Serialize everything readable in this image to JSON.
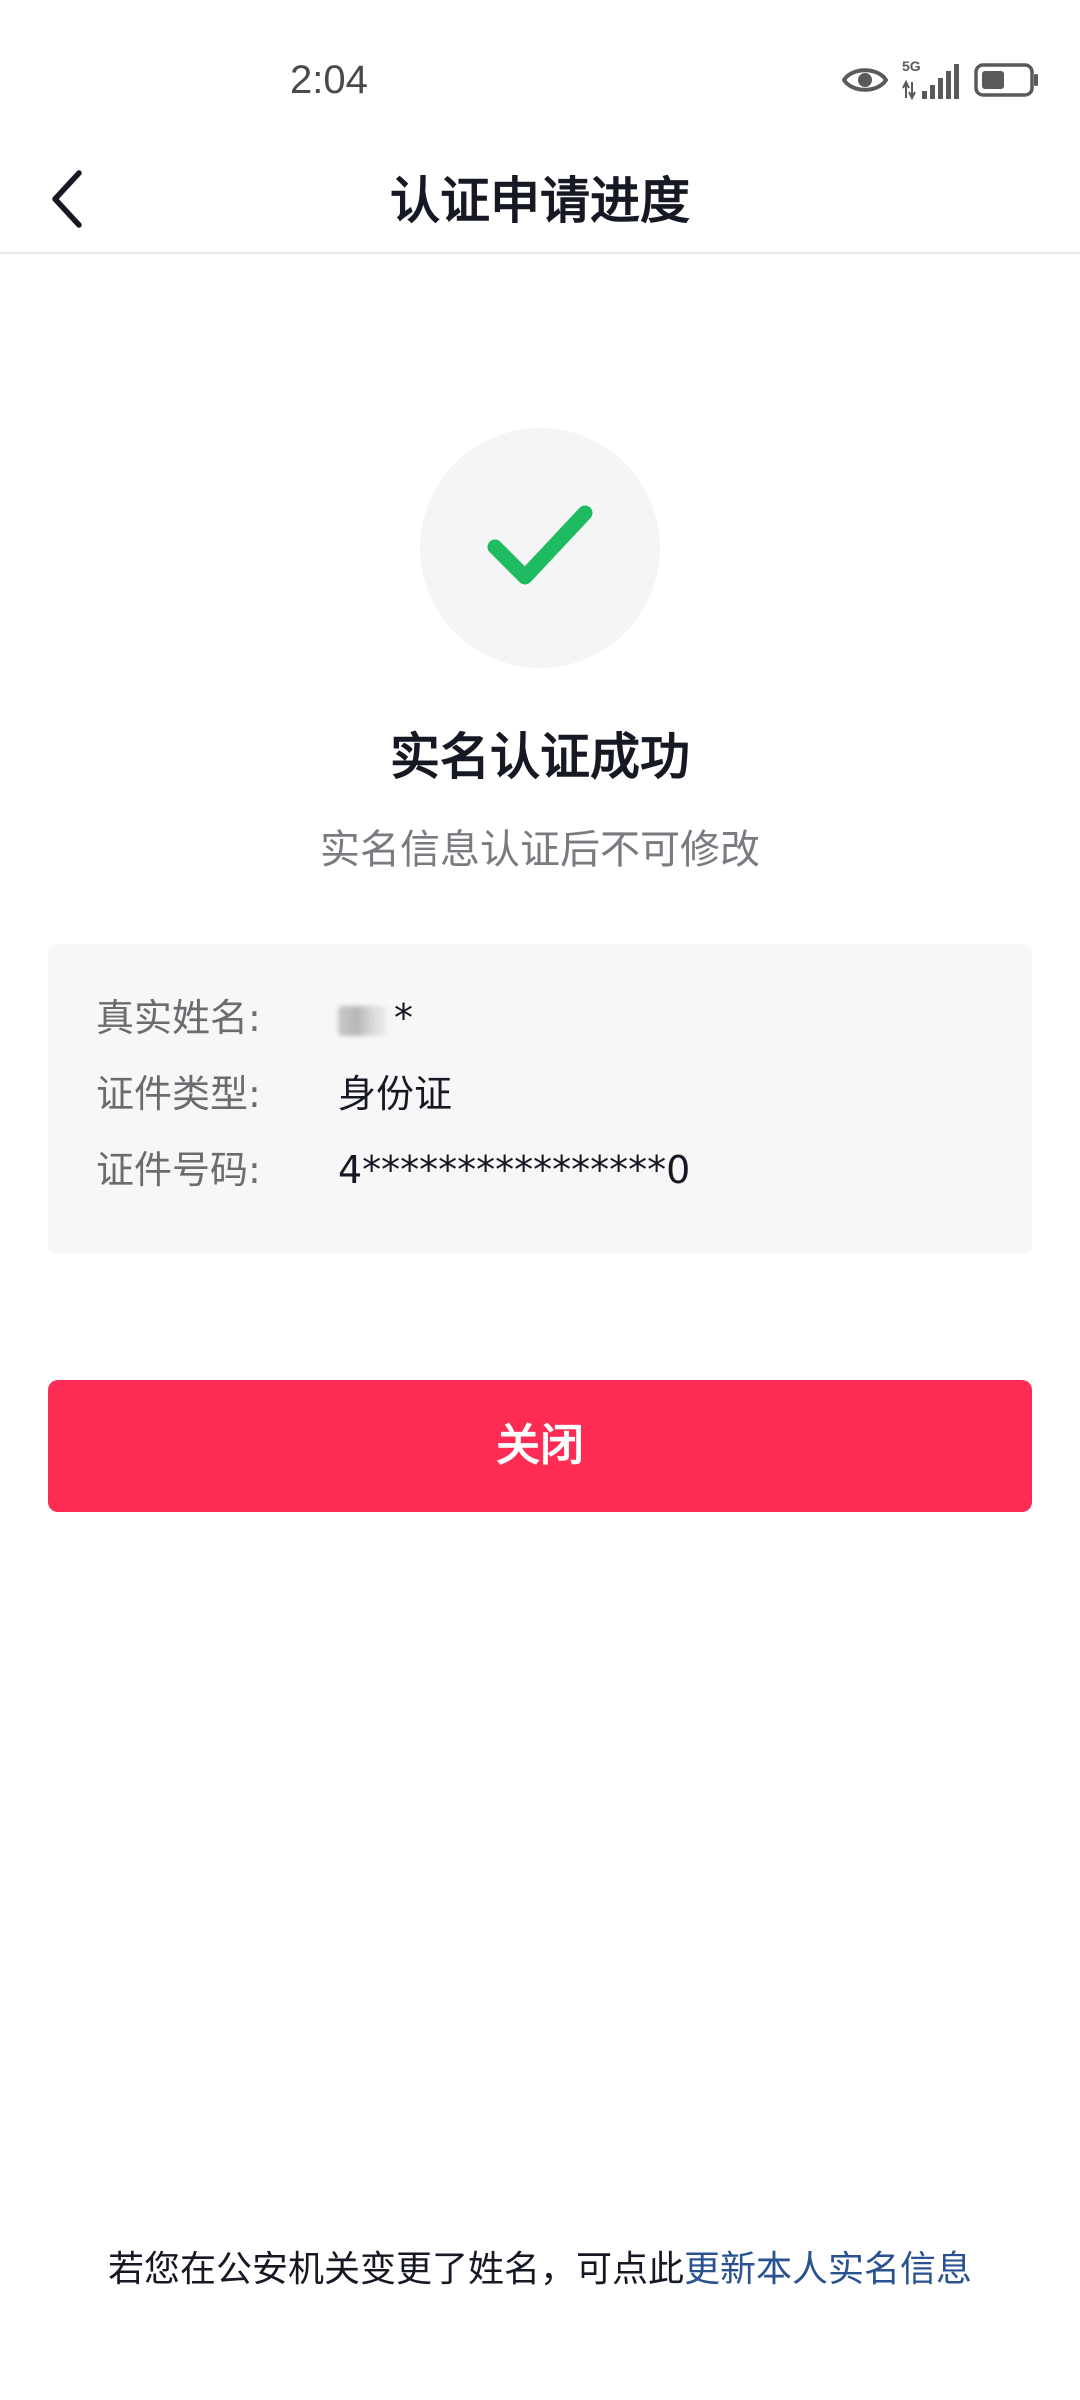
{
  "status_bar": {
    "time": "2:04",
    "network_label": "5G",
    "icons": [
      "eye-icon",
      "signal-icon",
      "battery-icon"
    ]
  },
  "nav": {
    "title": "认证申请进度",
    "back_icon": "chevron-left-icon"
  },
  "result": {
    "icon": "check-icon",
    "icon_color": "#1fbb61",
    "title": "实名认证成功",
    "subtitle": "实名信息认证后不可修改"
  },
  "info": {
    "rows": [
      {
        "label": "真实姓名:",
        "value": "*"
      },
      {
        "label": "证件类型:",
        "value": "身份证"
      },
      {
        "label": "证件号码:",
        "value": "4****************0"
      }
    ]
  },
  "actions": {
    "close_label": "关闭",
    "close_color": "#fe2c55"
  },
  "footer": {
    "note": "若您在公安机关变更了姓名，可点此",
    "link": "更新本人实名信息",
    "link_color": "#2a5290"
  }
}
